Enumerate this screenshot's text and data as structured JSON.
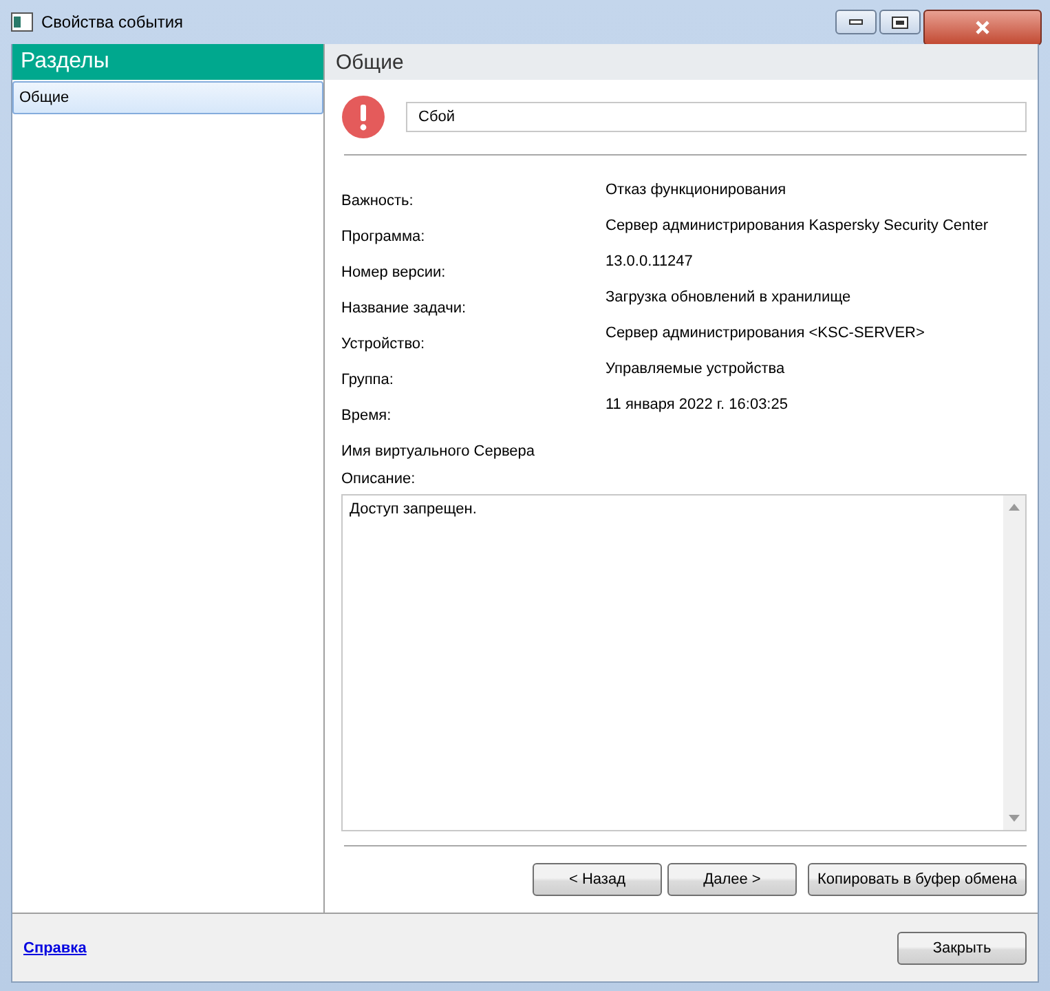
{
  "window": {
    "title": "Свойства события"
  },
  "sidebar": {
    "heading": "Разделы",
    "items": [
      {
        "label": "Общие",
        "selected": true
      }
    ]
  },
  "section": {
    "title": "Общие",
    "event_name": "Сбой",
    "fields": [
      {
        "label": "Важность:",
        "value": "Отказ функционирования"
      },
      {
        "label": "Программа:",
        "value": "Сервер администрирования Kaspersky Security Center"
      },
      {
        "label": "Номер версии:",
        "value": "13.0.0.11247"
      },
      {
        "label": "Название задачи:",
        "value": "Загрузка обновлений в хранилище"
      },
      {
        "label": "Устройство:",
        "value": "Сервер администрирования <KSC-SERVER>"
      },
      {
        "label": "Группа:",
        "value": "Управляемые устройства"
      },
      {
        "label": "Время:",
        "value": "11 января 2022 г. 16:03:25"
      },
      {
        "label": "Имя виртуального Сервера"
      }
    ],
    "description_label": "Описание:",
    "description": "Доступ запрещен.",
    "buttons": [
      "< Назад",
      "Далее >",
      "Копировать в буфер обмена"
    ]
  },
  "footer": {
    "help_link": "Справка",
    "close_button": "Закрыть"
  }
}
